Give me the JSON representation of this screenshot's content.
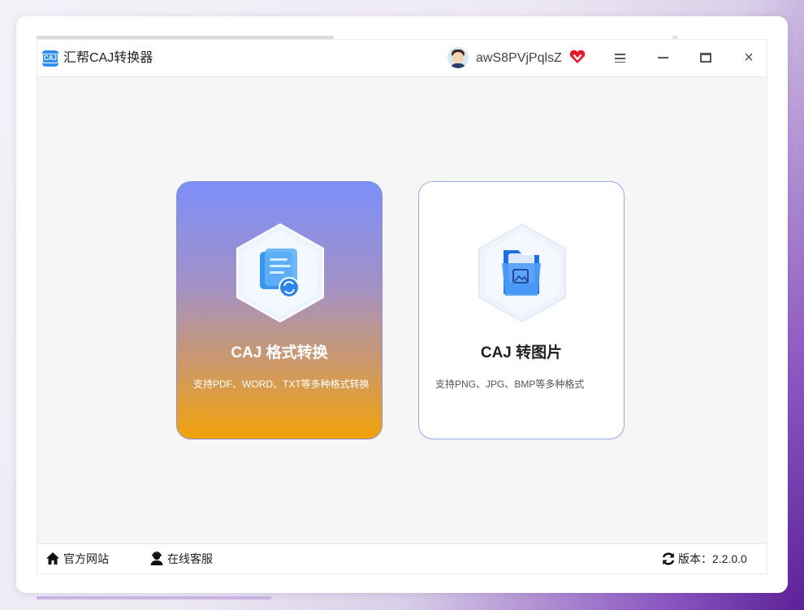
{
  "window": {
    "title": "汇帮CAJ转换器",
    "logo_text": "CAJ",
    "username": "awS8PVjPqlsZ"
  },
  "icons": {
    "logo": "caj-logo-icon",
    "avatar": "user-avatar-icon",
    "vip": "vip-heart-icon",
    "menu": "menu-icon",
    "minimize": "minimize-icon",
    "maximize": "maximize-icon",
    "close": "close-icon",
    "home": "home-icon",
    "support": "customer-service-icon",
    "refresh": "refresh-icon"
  },
  "window_controls": {
    "close_glyph": "×"
  },
  "features": [
    {
      "title": "CAJ 格式转换",
      "description": "支持PDF、WORD、TXT等多种格式转换",
      "icon": "document-convert-icon"
    },
    {
      "title": "CAJ 转图片",
      "description": "支持PNG、JPG、BMP等多种格式",
      "icon": "folder-image-icon"
    }
  ],
  "statusbar": {
    "home_label": "官方网站",
    "support_label": "在线客服",
    "version_label": "版本：2.2.0.0"
  },
  "colors": {
    "accent": "#2f8ff0",
    "card1_top": "#7c8ff8",
    "card1_bottom": "#f1a20a",
    "card2_border": "#97a9e6",
    "vip": "#e8192c"
  }
}
